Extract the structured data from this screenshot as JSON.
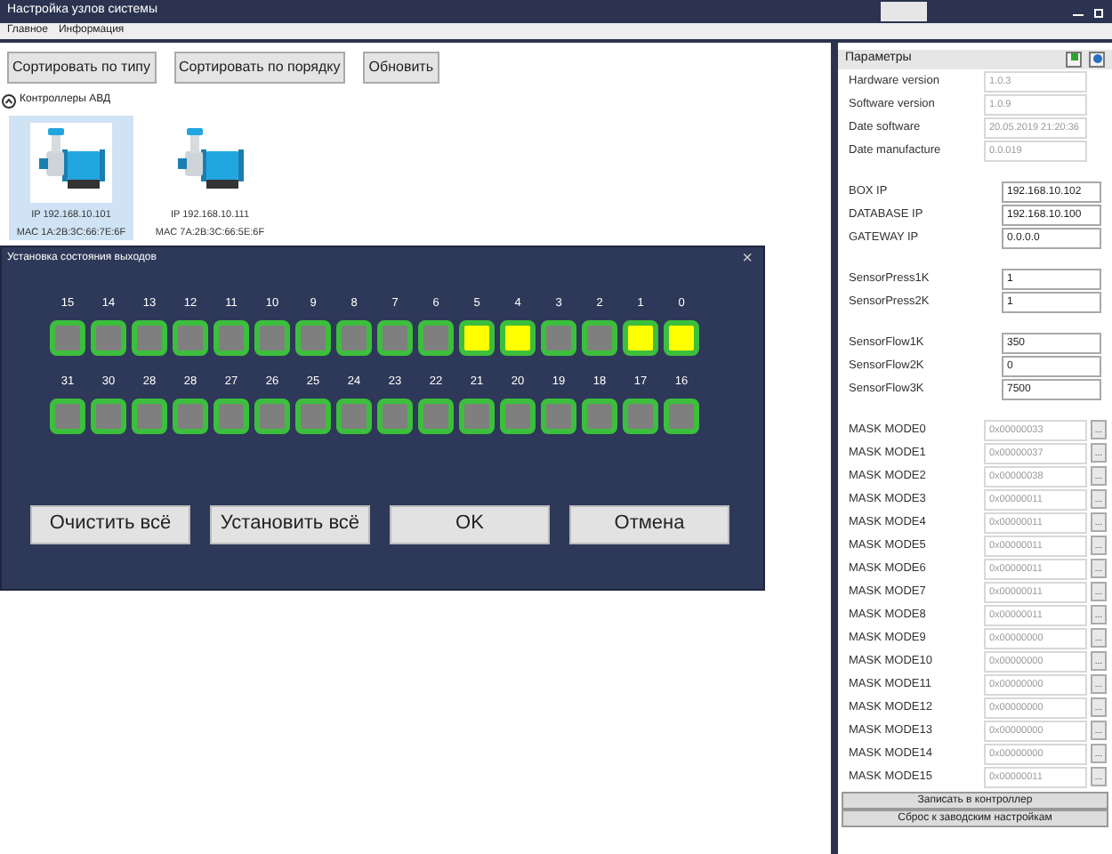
{
  "window": {
    "title": "Настройка узлов системы"
  },
  "menu": [
    "Главное",
    "Информация"
  ],
  "toolbar": [
    "Сортировать по типу",
    "Сортировать по порядку",
    "Обновить"
  ],
  "group": {
    "label": "Контроллеры АВД",
    "expanded": true
  },
  "devices": [
    {
      "ip": "IP 192.168.10.101",
      "mac": "MAC 1A:2B:3C:66:7E:6F",
      "selected": true
    },
    {
      "ip": "IP 192.168.10.111",
      "mac": "MAC 7A:2B:3C:66:5E:6F",
      "selected": false
    }
  ],
  "dialog": {
    "title": "Установка состояния выходов",
    "close": "×",
    "rows": [
      [
        {
          "label": "15",
          "on": false
        },
        {
          "label": "14",
          "on": false
        },
        {
          "label": "13",
          "on": false
        },
        {
          "label": "12",
          "on": false
        },
        {
          "label": "11",
          "on": false
        },
        {
          "label": "10",
          "on": false
        },
        {
          "label": "9",
          "on": false
        },
        {
          "label": "8",
          "on": false
        },
        {
          "label": "7",
          "on": false
        },
        {
          "label": "6",
          "on": false
        },
        {
          "label": "5",
          "on": true
        },
        {
          "label": "4",
          "on": true
        },
        {
          "label": "3",
          "on": false
        },
        {
          "label": "2",
          "on": false
        },
        {
          "label": "1",
          "on": true
        },
        {
          "label": "0",
          "on": true
        }
      ],
      [
        {
          "label": "31",
          "on": false
        },
        {
          "label": "30",
          "on": false
        },
        {
          "label": "28",
          "on": false
        },
        {
          "label": "28",
          "on": false
        },
        {
          "label": "27",
          "on": false
        },
        {
          "label": "26",
          "on": false
        },
        {
          "label": "25",
          "on": false
        },
        {
          "label": "24",
          "on": false
        },
        {
          "label": "23",
          "on": false
        },
        {
          "label": "22",
          "on": false
        },
        {
          "label": "21",
          "on": false
        },
        {
          "label": "20",
          "on": false
        },
        {
          "label": "19",
          "on": false
        },
        {
          "label": "18",
          "on": false
        },
        {
          "label": "17",
          "on": false
        },
        {
          "label": "16",
          "on": false
        }
      ]
    ],
    "buttons": [
      "Очистить всё",
      "Установить всё",
      "OK",
      "Отмена"
    ]
  },
  "params": {
    "title": "Параметры",
    "sections": [
      [
        {
          "label": "Hardware version",
          "value": "1.0.3",
          "kind": "readonly"
        },
        {
          "label": "Software version",
          "value": "1.0.9",
          "kind": "readonly"
        },
        {
          "label": "Date software",
          "value": "20.05.2019 21:20:36",
          "kind": "readonly"
        },
        {
          "label": "Date manufacture",
          "value": "0.0.019",
          "kind": "readonly"
        }
      ],
      [
        {
          "label": "BOX IP",
          "value": "192.168.10.102",
          "kind": "input"
        },
        {
          "label": "DATABASE IP",
          "value": "192.168.10.100",
          "kind": "input"
        },
        {
          "label": "GATEWAY IP",
          "value": "0.0.0.0",
          "kind": "input"
        }
      ],
      [
        {
          "label": "SensorPress1K",
          "value": "1",
          "kind": "input"
        },
        {
          "label": "SensorPress2K",
          "value": "1",
          "kind": "input"
        }
      ],
      [
        {
          "label": "SensorFlow1K",
          "value": "350",
          "kind": "input"
        },
        {
          "label": "SensorFlow2K",
          "value": "0",
          "kind": "input"
        },
        {
          "label": "SensorFlow3K",
          "value": "7500",
          "kind": "input"
        }
      ],
      [
        {
          "label": "MASK MODE0",
          "value": "0x00000033",
          "kind": "mask",
          "button": "..."
        },
        {
          "label": "MASK MODE1",
          "value": "0x00000037",
          "kind": "mask",
          "button": "..."
        },
        {
          "label": "MASK MODE2",
          "value": "0x00000038",
          "kind": "mask",
          "button": "..."
        },
        {
          "label": "MASK MODE3",
          "value": "0x00000011",
          "kind": "mask",
          "button": "..."
        },
        {
          "label": "MASK MODE4",
          "value": "0x00000011",
          "kind": "mask",
          "button": "..."
        },
        {
          "label": "MASK MODE5",
          "value": "0x00000011",
          "kind": "mask",
          "button": "..."
        },
        {
          "label": "MASK MODE6",
          "value": "0x00000011",
          "kind": "mask",
          "button": "..."
        },
        {
          "label": "MASK MODE7",
          "value": "0x00000011",
          "kind": "mask",
          "button": "..."
        },
        {
          "label": "MASK MODE8",
          "value": "0x00000011",
          "kind": "mask",
          "button": "..."
        },
        {
          "label": "MASK MODE9",
          "value": "0x00000000",
          "kind": "mask",
          "button": "..."
        },
        {
          "label": "MASK MODE10",
          "value": "0x00000000",
          "kind": "mask",
          "button": "..."
        },
        {
          "label": "MASK MODE11",
          "value": "0x00000000",
          "kind": "mask",
          "button": "..."
        },
        {
          "label": "MASK MODE12",
          "value": "0x00000000",
          "kind": "mask",
          "button": "..."
        },
        {
          "label": "MASK MODE13",
          "value": "0x00000000",
          "kind": "mask",
          "button": "..."
        },
        {
          "label": "MASK MODE14",
          "value": "0x00000000",
          "kind": "mask",
          "button": "..."
        },
        {
          "label": "MASK MODE15",
          "value": "0x00000011",
          "kind": "mask",
          "button": "..."
        }
      ]
    ],
    "buttons": [
      "Записать в контроллер",
      "Сброс к заводским настройкам"
    ]
  }
}
